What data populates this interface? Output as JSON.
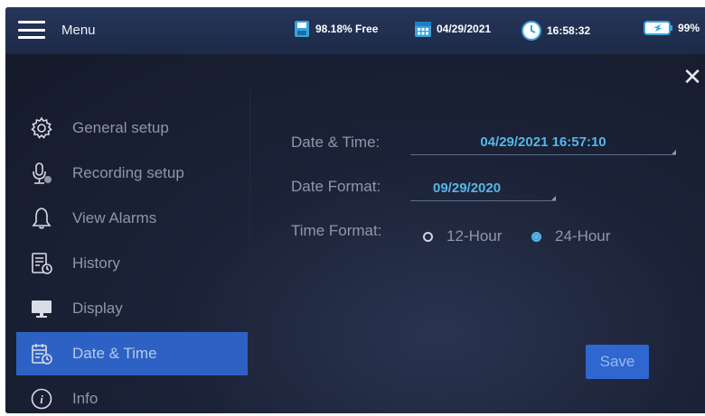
{
  "topbar": {
    "menu_label": "Menu",
    "storage": "98.18% Free",
    "date": "04/29/2021",
    "time": "16:58:32",
    "battery": "99%",
    "icons": [
      "menu-icon",
      "storage-icon",
      "calendar-icon",
      "clock-icon",
      "battery-icon"
    ]
  },
  "sidebar": {
    "items": [
      {
        "label": "General setup",
        "icon": "gear-icon"
      },
      {
        "label": "Recording setup",
        "icon": "microphone-icon"
      },
      {
        "label": "View Alarms",
        "icon": "bell-icon"
      },
      {
        "label": "History",
        "icon": "history-icon"
      },
      {
        "label": "Display",
        "icon": "monitor-icon"
      },
      {
        "label": "Date & Time",
        "icon": "calendar-clock-icon",
        "active": true
      },
      {
        "label": "Info",
        "icon": "info-icon"
      }
    ]
  },
  "form": {
    "datetime_label": "Date & Time:",
    "datetime_value": "04/29/2021 16:57:10",
    "dateformat_label": "Date Format:",
    "dateformat_value": "09/29/2020",
    "timeformat_label": "Time Format:",
    "option_12": "12-Hour",
    "option_24": "24-Hour",
    "selected": "24-Hour"
  },
  "save_label": "Save",
  "colors": {
    "accent": "#55b7e6",
    "active_item": "#2d62c4",
    "save_button": "#2f66cf",
    "background": "#141b29"
  }
}
